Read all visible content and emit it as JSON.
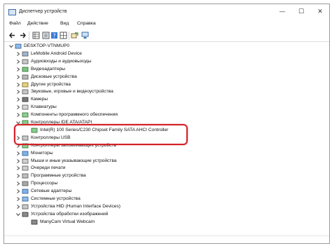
{
  "window": {
    "title": "Диспетчер устройств"
  },
  "window_controls": {
    "minimize": "—",
    "maximize": "☐",
    "close": "✕"
  },
  "menu": [
    "Файл",
    "Действие",
    "Вид",
    "Справка"
  ],
  "colors": {
    "highlight_border": "#d42027",
    "toolbar_accent": "#3a7bd5"
  },
  "tree": {
    "root": "DESKTOP-VTNMUP0",
    "items": [
      {
        "label": "LeMobile Android Device",
        "icon": "phone-icon"
      },
      {
        "label": "Аудиовходы и аудиовыходы",
        "icon": "speaker-icon"
      },
      {
        "label": "Видеоадаптеры",
        "icon": "display-adapter-icon"
      },
      {
        "label": "Дисковые устройства",
        "icon": "disk-icon"
      },
      {
        "label": "Другие устройства",
        "icon": "unknown-device-icon"
      },
      {
        "label": "Звуковые, игровые и видеоустройства",
        "icon": "sound-icon"
      },
      {
        "label": "Камеры",
        "icon": "camera-icon"
      },
      {
        "label": "Клавиатуры",
        "icon": "keyboard-icon"
      },
      {
        "label": "Компоненты программного обеспечения",
        "icon": "software-component-icon"
      },
      {
        "label": "Контроллеры IDE ATA/ATAPI",
        "icon": "ide-controller-icon",
        "expanded": true
      },
      {
        "label": "Intel(R) 100 Series/C230 Chipset Family SATA AHCI Controller",
        "icon": "controller-icon",
        "child": true
      },
      {
        "label": "Контроллеры USB",
        "icon": "usb-icon"
      },
      {
        "label": "Контроллеры запоминающих устройств",
        "icon": "storage-controller-icon"
      },
      {
        "label": "Мониторы",
        "icon": "monitor-icon"
      },
      {
        "label": "Мыши и иные указывающие устройства",
        "icon": "mouse-icon"
      },
      {
        "label": "Очереди печати",
        "icon": "printer-icon"
      },
      {
        "label": "Программные устройства",
        "icon": "software-device-icon"
      },
      {
        "label": "Процессоры",
        "icon": "processor-icon"
      },
      {
        "label": "Сетевые адаптеры",
        "icon": "network-adapter-icon"
      },
      {
        "label": "Системные устройства",
        "icon": "system-device-icon"
      },
      {
        "label": "Устройства HID (Human Interface Devices)",
        "icon": "hid-icon"
      },
      {
        "label": "Устройства обработки изображений",
        "icon": "imaging-device-icon",
        "expanded": true
      },
      {
        "label": "ManyCam Virtual Webcam",
        "icon": "webcam-icon",
        "child": true
      }
    ]
  }
}
